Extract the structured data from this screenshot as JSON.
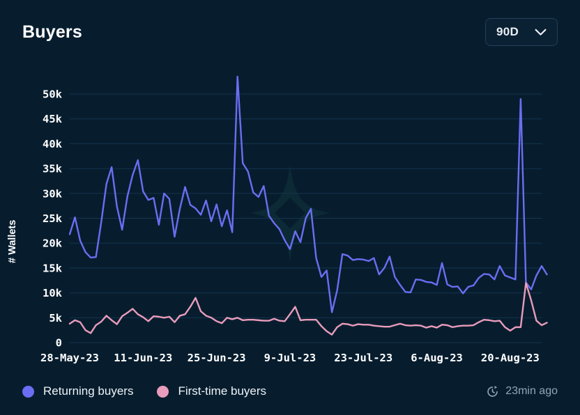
{
  "header": {
    "title": "Buyers",
    "range_select": {
      "value": "90D",
      "icon": "chevron-down-icon"
    }
  },
  "footer": {
    "legend": [
      {
        "label": "Returning buyers",
        "color": "#6b6ef2"
      },
      {
        "label": "First-time buyers",
        "color": "#e99cbb"
      }
    ],
    "updated": {
      "icon": "clock-refresh-icon",
      "text": "23min ago"
    }
  },
  "colors": {
    "card_background": "#071d2e",
    "page_background": "#061826",
    "grid": "#14344d",
    "axis_text": "#ffffff",
    "watermark": "#12383c",
    "returning": "#6b6ef2",
    "first_time": "#e99cbb"
  },
  "chart_data": {
    "type": "line",
    "title": "Buyers",
    "xlabel": "",
    "ylabel": "# Wallets",
    "ylim": [
      0,
      52000
    ],
    "yticks": [
      0,
      5000,
      10000,
      15000,
      20000,
      25000,
      30000,
      35000,
      40000,
      45000,
      50000
    ],
    "ytick_labels": [
      "0",
      "5k",
      "10k",
      "15k",
      "20k",
      "25k",
      "30k",
      "35k",
      "40k",
      "45k",
      "50k"
    ],
    "grid": true,
    "legend_position": "bottom-left",
    "xtick_labels": [
      "28-May-23",
      "11-Jun-23",
      "25-Jun-23",
      "9-Jul-23",
      "23-Jul-23",
      "6-Aug-23",
      "20-Aug-23"
    ],
    "xtick_indices": [
      0,
      14,
      28,
      42,
      56,
      70,
      84
    ],
    "x": [
      "28-May-23",
      "29-May-23",
      "30-May-23",
      "31-May-23",
      "1-Jun-23",
      "2-Jun-23",
      "3-Jun-23",
      "4-Jun-23",
      "5-Jun-23",
      "6-Jun-23",
      "7-Jun-23",
      "8-Jun-23",
      "9-Jun-23",
      "10-Jun-23",
      "11-Jun-23",
      "12-Jun-23",
      "13-Jun-23",
      "14-Jun-23",
      "15-Jun-23",
      "16-Jun-23",
      "17-Jun-23",
      "18-Jun-23",
      "19-Jun-23",
      "20-Jun-23",
      "21-Jun-23",
      "22-Jun-23",
      "23-Jun-23",
      "24-Jun-23",
      "25-Jun-23",
      "26-Jun-23",
      "27-Jun-23",
      "28-Jun-23",
      "29-Jun-23",
      "30-Jun-23",
      "1-Jul-23",
      "2-Jul-23",
      "3-Jul-23",
      "4-Jul-23",
      "5-Jul-23",
      "6-Jul-23",
      "7-Jul-23",
      "8-Jul-23",
      "9-Jul-23",
      "10-Jul-23",
      "11-Jul-23",
      "12-Jul-23",
      "13-Jul-23",
      "14-Jul-23",
      "15-Jul-23",
      "16-Jul-23",
      "17-Jul-23",
      "18-Jul-23",
      "19-Jul-23",
      "20-Jul-23",
      "21-Jul-23",
      "22-Jul-23",
      "23-Jul-23",
      "24-Jul-23",
      "25-Jul-23",
      "26-Jul-23",
      "27-Jul-23",
      "28-Jul-23",
      "29-Jul-23",
      "30-Jul-23",
      "31-Jul-23",
      "1-Aug-23",
      "2-Aug-23",
      "3-Aug-23",
      "4-Aug-23",
      "5-Aug-23",
      "6-Aug-23",
      "7-Aug-23",
      "8-Aug-23",
      "9-Aug-23",
      "10-Aug-23",
      "11-Aug-23",
      "12-Aug-23",
      "13-Aug-23",
      "14-Aug-23",
      "15-Aug-23",
      "16-Aug-23",
      "17-Aug-23",
      "18-Aug-23",
      "19-Aug-23",
      "20-Aug-23",
      "21-Aug-23",
      "22-Aug-23",
      "23-Aug-23",
      "24-Aug-23",
      "25-Aug-23",
      "26-Aug-23"
    ],
    "series": [
      {
        "name": "Returning buyers",
        "color": "#6b6ef2",
        "values": [
          21800,
          25200,
          20500,
          18200,
          17100,
          17200,
          24100,
          31900,
          35300,
          27400,
          22700,
          29400,
          33700,
          36700,
          30400,
          28700,
          29100,
          23700,
          30000,
          28900,
          21300,
          26900,
          31300,
          27700,
          27000,
          25700,
          28600,
          24400,
          27800,
          23400,
          26600,
          22200,
          53500,
          36100,
          34400,
          30200,
          29300,
          31500,
          25500,
          24000,
          22800,
          20600,
          18800,
          22400,
          20200,
          25000,
          26900,
          17000,
          13200,
          14500,
          6100,
          10500,
          17800,
          17500,
          16600,
          16800,
          16700,
          16400,
          17000,
          13700,
          15000,
          17300,
          13200,
          11600,
          10200,
          10100,
          12700,
          12600,
          12200,
          12100,
          11600,
          16000,
          11700,
          11200,
          11300,
          9900,
          11200,
          11500,
          13000,
          13800,
          13700,
          12700,
          15400,
          13500,
          13100,
          12700,
          49000,
          12100,
          10700,
          13500,
          15400,
          13700
        ],
        "max": 53500,
        "min": 6100
      },
      {
        "name": "First-time buyers",
        "color": "#e99cbb",
        "values": [
          3800,
          4500,
          4100,
          2500,
          1900,
          3500,
          4200,
          5400,
          4500,
          3700,
          5300,
          6000,
          6800,
          5700,
          5100,
          4300,
          5300,
          5200,
          5000,
          5200,
          4100,
          5400,
          5700,
          7200,
          9000,
          6300,
          5400,
          5000,
          4300,
          3900,
          5000,
          4700,
          5000,
          4500,
          4600,
          4600,
          4500,
          4400,
          4400,
          4800,
          4400,
          4300,
          5700,
          7200,
          4500,
          4600,
          4600,
          4600,
          3300,
          2300,
          1600,
          3100,
          3800,
          3700,
          3400,
          3700,
          3600,
          3600,
          3400,
          3300,
          3200,
          3200,
          3500,
          3800,
          3500,
          3400,
          3500,
          3400,
          3000,
          3300,
          3000,
          3600,
          3500,
          3100,
          3300,
          3400,
          3400,
          3500,
          4100,
          4600,
          4500,
          4300,
          4400,
          3100,
          2400,
          3100,
          3100,
          12000,
          8500,
          4400,
          3500,
          4000
        ],
        "max": 12000,
        "min": 1600
      }
    ]
  }
}
